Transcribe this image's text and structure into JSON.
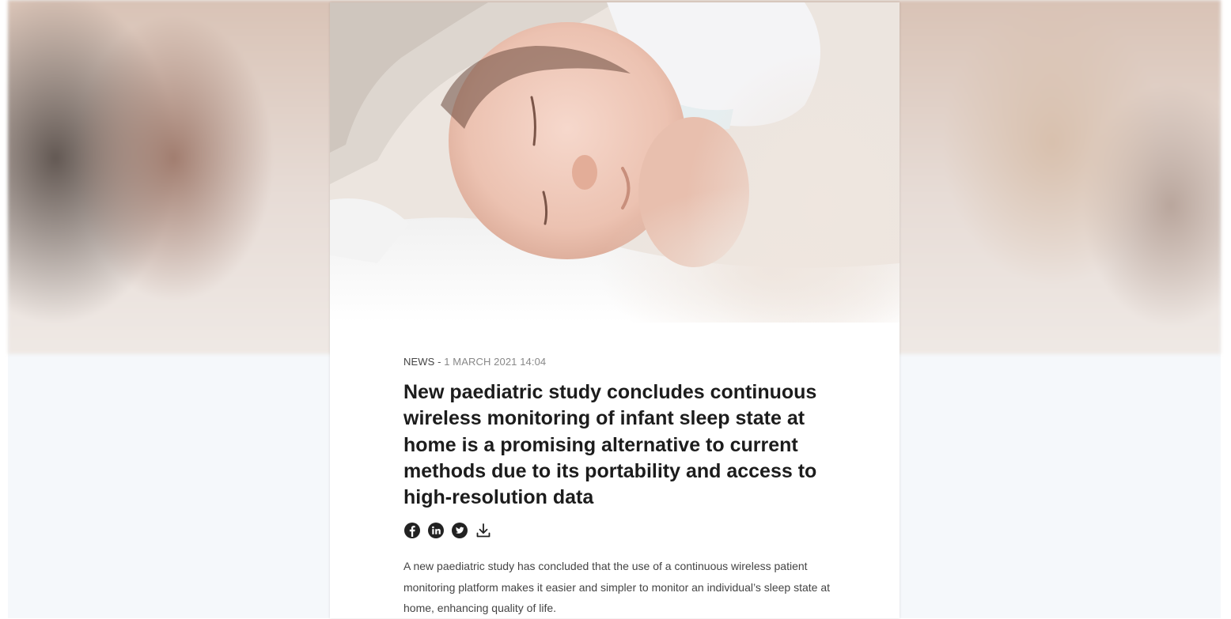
{
  "hero": {
    "image_alt": "Sleeping baby"
  },
  "article": {
    "category": "NEWS",
    "separator": " - ",
    "date": "1 MARCH 2021 14:04",
    "title": "New paediatric study concludes continuous wireless monitoring of infant sleep state at home is a promising alternative to current methods due to its portability and access to high-resolution data",
    "share_icons": [
      "facebook-icon",
      "linkedin-icon",
      "twitter-icon",
      "download-icon"
    ],
    "lead": "A new paediatric study has concluded that the use of a continuous wireless patient monitoring platform makes it easier and simpler to monitor an individual’s sleep state at home, enhancing quality of life."
  },
  "colors": {
    "page_background": "#f5f8fb",
    "card_background": "#ffffff",
    "title": "#1c1c1c",
    "icon": "#222222"
  }
}
